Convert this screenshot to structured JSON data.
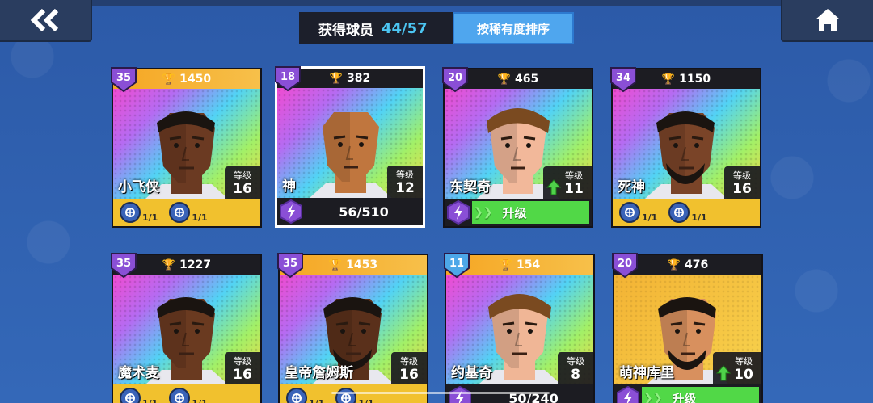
{
  "header": {
    "label": "获得球员",
    "count": "44/57",
    "sort_button": "按稀有度排序"
  },
  "level_label": "等级",
  "upgrade_label": "升级",
  "cards": [
    {
      "rank": "35",
      "trophies": "1450",
      "name": "小飞侠",
      "level": "16",
      "skills": [
        "1/1",
        "1/1"
      ],
      "skill_icons": [
        "dribble-icon",
        "pass-icon"
      ]
    },
    {
      "rank": "18",
      "trophies": "382",
      "name": "神",
      "level": "12",
      "shards": "56/510"
    },
    {
      "rank": "20",
      "trophies": "465",
      "name": "东契奇",
      "level": "11"
    },
    {
      "rank": "34",
      "trophies": "1150",
      "name": "死神",
      "level": "16",
      "skills": [
        "1/1",
        "1/1"
      ],
      "skill_icons": [
        "dunk-icon",
        "block-icon"
      ]
    },
    {
      "rank": "35",
      "trophies": "1227",
      "name": "魔术麦",
      "level": "16",
      "skills": [
        "1/1",
        "1/1"
      ]
    },
    {
      "rank": "35",
      "trophies": "1453",
      "name": "皇帝詹姆斯",
      "level": "16",
      "skills": [
        "1/1",
        "1/1"
      ]
    },
    {
      "rank": "11",
      "trophies": "154",
      "name": "约基奇",
      "level": "8",
      "shards": "50/240"
    },
    {
      "rank": "20",
      "trophies": "476",
      "name": "萌神库里",
      "level": "10"
    }
  ],
  "colors": {
    "background": "#2f62b2",
    "trophy_bar": "#f5a623",
    "upgrade_green": "#51d847",
    "skill_bar": "#f1c12e",
    "rank_badge": "#8a4fd6"
  }
}
